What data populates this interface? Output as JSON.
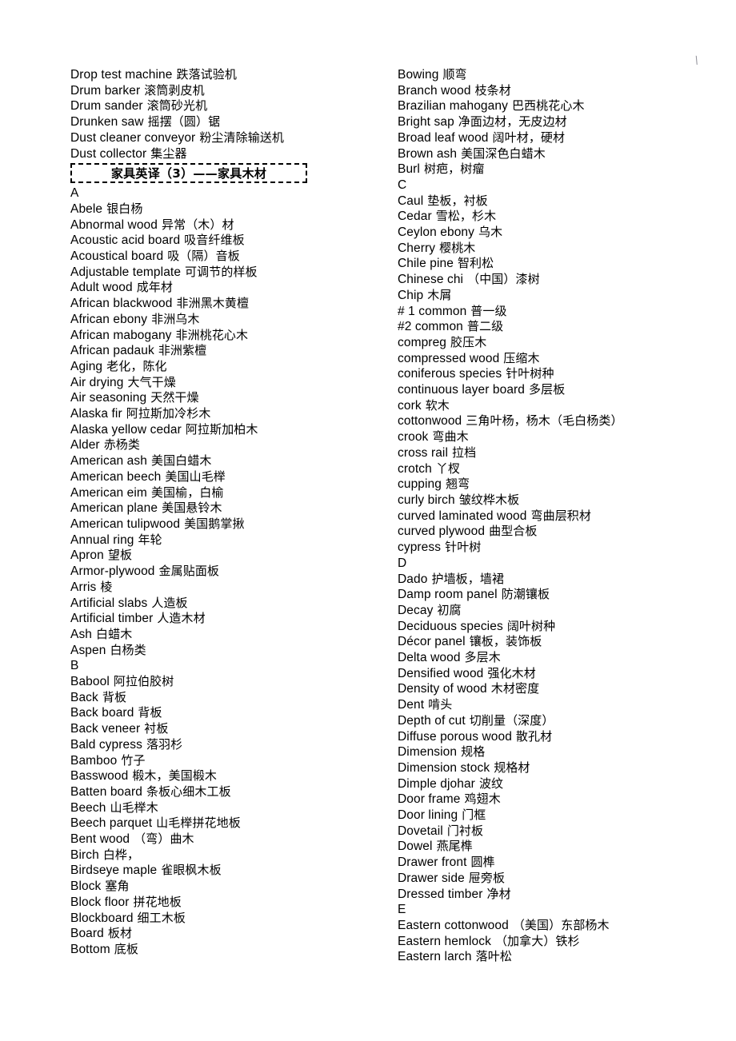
{
  "document": {
    "corner_mark": "\\",
    "section_header": "家具英译（3）——家具木材"
  },
  "left_column": [
    {
      "type": "entry",
      "en": "Drop test machine",
      "zh": "跌落试验机"
    },
    {
      "type": "entry",
      "en": "Drum barker",
      "zh": "滚筒剥皮机"
    },
    {
      "type": "entry",
      "en": "Drum sander",
      "zh": "滚筒砂光机"
    },
    {
      "type": "entry",
      "en": "Drunken saw",
      "zh": "摇摆（圆）锯"
    },
    {
      "type": "entry",
      "en": "Dust cleaner conveyor",
      "zh": "粉尘清除输送机"
    },
    {
      "type": "entry",
      "en": "Dust collector",
      "zh": "集尘器"
    },
    {
      "type": "section",
      "title": "家具英译（3）——家具木材"
    },
    {
      "type": "letter",
      "en": "A"
    },
    {
      "type": "entry",
      "en": "Abele",
      "zh": "银白杨"
    },
    {
      "type": "entry",
      "en": "Abnormal wood",
      "zh": "异常（木）材"
    },
    {
      "type": "entry",
      "en": "Acoustic acid board",
      "zh": "吸音纤维板"
    },
    {
      "type": "entry",
      "en": "Acoustical board",
      "zh": "吸（隔）音板"
    },
    {
      "type": "entry",
      "en": "Adjustable template",
      "zh": "可调节的样板"
    },
    {
      "type": "entry",
      "en": "Adult wood",
      "zh": "成年材"
    },
    {
      "type": "entry",
      "en": "African blackwood",
      "zh": "非洲黑木黄檀"
    },
    {
      "type": "entry",
      "en": "African ebony",
      "zh": "非洲乌木"
    },
    {
      "type": "entry",
      "en": "African mabogany",
      "zh": "非洲桃花心木"
    },
    {
      "type": "entry",
      "en": "African padauk",
      "zh": "非洲紫檀"
    },
    {
      "type": "entry",
      "en": "Aging",
      "zh": "老化，陈化"
    },
    {
      "type": "entry",
      "en": "Air drying",
      "zh": "大气干燥"
    },
    {
      "type": "entry",
      "en": "Air seasoning",
      "zh": "天然干燥"
    },
    {
      "type": "entry",
      "en": "Alaska fir",
      "zh": "阿拉斯加冷杉木"
    },
    {
      "type": "entry",
      "en": "Alaska yellow cedar",
      "zh": "阿拉斯加柏木"
    },
    {
      "type": "entry",
      "en": "Alder",
      "zh": "赤杨类"
    },
    {
      "type": "entry",
      "en": "American ash",
      "zh": "美国白蜡木"
    },
    {
      "type": "entry",
      "en": "American beech",
      "zh": "美国山毛榉"
    },
    {
      "type": "entry",
      "en": "American eim",
      "zh": "美国榆，白榆"
    },
    {
      "type": "entry",
      "en": "American plane",
      "zh": "美国悬铃木"
    },
    {
      "type": "entry",
      "en": "American tulipwood",
      "zh": "美国鹅掌揪"
    },
    {
      "type": "entry",
      "en": "Annual ring",
      "zh": "年轮"
    },
    {
      "type": "entry",
      "en": "Apron",
      "zh": "望板"
    },
    {
      "type": "entry",
      "en": "Armor-plywood",
      "zh": "金属贴面板"
    },
    {
      "type": "entry",
      "en": "Arris",
      "zh": "棱"
    },
    {
      "type": "entry",
      "en": "Artificial slabs",
      "zh": "人造板"
    },
    {
      "type": "entry",
      "en": "Artificial timber",
      "zh": "人造木材"
    },
    {
      "type": "entry",
      "en": "Ash",
      "zh": "白蜡木"
    },
    {
      "type": "entry",
      "en": "Aspen",
      "zh": "白杨类"
    },
    {
      "type": "letter",
      "en": "B"
    },
    {
      "type": "entry",
      "en": "Babool",
      "zh": "阿拉伯胶树"
    },
    {
      "type": "entry",
      "en": "Back",
      "zh": "背板"
    },
    {
      "type": "entry",
      "en": "Back board",
      "zh": "背板"
    },
    {
      "type": "entry",
      "en": "Back veneer",
      "zh": "衬板"
    },
    {
      "type": "entry",
      "en": "Bald cypress",
      "zh": "落羽杉"
    },
    {
      "type": "entry",
      "en": "Bamboo",
      "zh": "竹子"
    },
    {
      "type": "entry",
      "en": "Basswood",
      "zh": "椴木，美国椴木"
    },
    {
      "type": "entry",
      "en": "Batten board",
      "zh": "条板心细木工板"
    },
    {
      "type": "entry",
      "en": "Beech",
      "zh": "山毛榉木"
    },
    {
      "type": "entry",
      "en": "Beech parquet",
      "zh": "山毛榉拼花地板"
    },
    {
      "type": "entry",
      "en": "Bent wood",
      "zh": "（弯）曲木"
    },
    {
      "type": "entry",
      "en": "Birch",
      "zh": "白桦，"
    },
    {
      "type": "entry",
      "en": "Birdseye maple",
      "zh": "雀眼枫木板"
    },
    {
      "type": "entry",
      "en": "Block",
      "zh": "塞角"
    },
    {
      "type": "entry",
      "en": "Block floor",
      "zh": "拼花地板"
    },
    {
      "type": "entry",
      "en": "Blockboard",
      "zh": "细工木板"
    },
    {
      "type": "entry",
      "en": "Board",
      "zh": "板材"
    },
    {
      "type": "entry",
      "en": "Bottom",
      "zh": "底板"
    }
  ],
  "right_column": [
    {
      "type": "entry",
      "en": "Bowing",
      "zh": "顺弯"
    },
    {
      "type": "entry",
      "en": "Branch wood",
      "zh": "枝条材"
    },
    {
      "type": "entry",
      "en": "Brazilian mahogany",
      "zh": "巴西桃花心木"
    },
    {
      "type": "entry",
      "en": "Bright sap",
      "zh": "净面边材，无皮边材"
    },
    {
      "type": "entry",
      "en": "Broad leaf wood",
      "zh": "阔叶材，硬材"
    },
    {
      "type": "entry",
      "en": "Brown ash",
      "zh": "美国深色白蜡木"
    },
    {
      "type": "entry",
      "en": "Burl",
      "zh": "树疤，树瘤"
    },
    {
      "type": "letter",
      "en": "C"
    },
    {
      "type": "entry",
      "en": "Caul",
      "zh": "垫板，衬板"
    },
    {
      "type": "entry",
      "en": "Cedar",
      "zh": "雪松，杉木"
    },
    {
      "type": "entry",
      "en": "Ceylon ebony",
      "zh": "乌木"
    },
    {
      "type": "entry",
      "en": "Cherry",
      "zh": "樱桃木"
    },
    {
      "type": "entry",
      "en": "Chile pine",
      "zh": "智利松"
    },
    {
      "type": "entry",
      "en": "Chinese chi",
      "zh": "（中国）漆树"
    },
    {
      "type": "entry",
      "en": "Chip",
      "zh": "木屑"
    },
    {
      "type": "entry",
      "en": "# 1 common",
      "zh": "普一级"
    },
    {
      "type": "entry",
      "en": "#2 common",
      "zh": "普二级"
    },
    {
      "type": "entry",
      "en": "compreg",
      "zh": "胶压木"
    },
    {
      "type": "entry",
      "en": "compressed wood",
      "zh": "压缩木"
    },
    {
      "type": "entry",
      "en": "coniferous species",
      "zh": "针叶树种"
    },
    {
      "type": "entry",
      "en": "continuous layer board",
      "zh": "多层板"
    },
    {
      "type": "entry",
      "en": "cork",
      "zh": "软木"
    },
    {
      "type": "entry",
      "en": "cottonwood",
      "zh": "三角叶杨，杨木（毛白杨类）"
    },
    {
      "type": "entry",
      "en": "crook",
      "zh": "弯曲木"
    },
    {
      "type": "entry",
      "en": "cross rail",
      "zh": "拉档"
    },
    {
      "type": "entry",
      "en": "crotch",
      "zh": "丫杈"
    },
    {
      "type": "entry",
      "en": "cupping",
      "zh": "翘弯"
    },
    {
      "type": "entry",
      "en": "curly birch",
      "zh": "皱纹桦木板"
    },
    {
      "type": "entry",
      "en": "curved laminated wood",
      "zh": "弯曲层积材"
    },
    {
      "type": "entry",
      "en": "curved plywood",
      "zh": "曲型合板"
    },
    {
      "type": "entry",
      "en": "cypress",
      "zh": "针叶树"
    },
    {
      "type": "letter",
      "en": "D"
    },
    {
      "type": "entry",
      "en": "Dado",
      "zh": "护墙板，墙裙"
    },
    {
      "type": "entry",
      "en": "Damp room panel",
      "zh": "防潮镶板"
    },
    {
      "type": "entry",
      "en": "Decay",
      "zh": "初腐"
    },
    {
      "type": "entry",
      "en": "Deciduous species",
      "zh": "阔叶树种"
    },
    {
      "type": "entry",
      "en": "Décor panel",
      "zh": "镶板，装饰板"
    },
    {
      "type": "entry",
      "en": "Delta wood",
      "zh": "多层木"
    },
    {
      "type": "entry",
      "en": "Densified wood",
      "zh": "强化木材"
    },
    {
      "type": "entry",
      "en": "Density of wood",
      "zh": "木材密度"
    },
    {
      "type": "entry",
      "en": "Dent",
      "zh": "啃头"
    },
    {
      "type": "entry",
      "en": "Depth of cut",
      "zh": "切削量（深度）"
    },
    {
      "type": "entry",
      "en": "Diffuse porous wood",
      "zh": "散孔材"
    },
    {
      "type": "entry",
      "en": "Dimension",
      "zh": "规格"
    },
    {
      "type": "entry",
      "en": "Dimension stock",
      "zh": "规格材"
    },
    {
      "type": "entry",
      "en": "Dimple djohar",
      "zh": "波纹"
    },
    {
      "type": "entry",
      "en": "Door frame",
      "zh": "鸡翅木"
    },
    {
      "type": "entry",
      "en": "Door lining",
      "zh": "门框"
    },
    {
      "type": "entry",
      "en": "Dovetail",
      "zh": "门衬板"
    },
    {
      "type": "entry",
      "en": "Dowel",
      "zh": "燕尾榫"
    },
    {
      "type": "entry",
      "en": "Drawer front",
      "zh": "圆榫"
    },
    {
      "type": "entry",
      "en": "Drawer side",
      "zh": "屉旁板"
    },
    {
      "type": "entry",
      "en": "Dressed timber",
      "zh": "净材"
    },
    {
      "type": "letter",
      "en": "E"
    },
    {
      "type": "entry",
      "en": "Eastern cottonwood",
      "zh": "（美国）东部杨木"
    },
    {
      "type": "entry",
      "en": "Eastern hemlock",
      "zh": "（加拿大）铁杉"
    },
    {
      "type": "entry",
      "en": "Eastern larch",
      "zh": "落叶松"
    }
  ]
}
